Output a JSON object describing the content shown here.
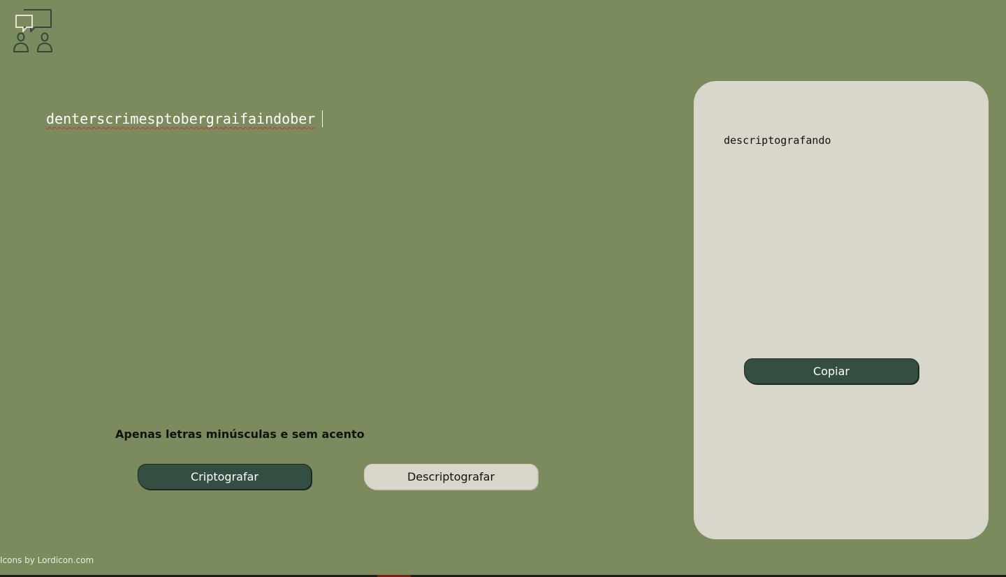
{
  "app": {
    "logo_icon": "chat-people-icon"
  },
  "input": {
    "value": "denterscrimesptobergraifaindober"
  },
  "hint": {
    "text": "Apenas letras minúsculas e sem acento"
  },
  "buttons": {
    "encrypt_label": "Criptografar",
    "decrypt_label": "Descriptografar"
  },
  "output": {
    "text": "descriptografando",
    "copy_label": "Copiar"
  },
  "footer": {
    "credit": "Icons by Lordicon.com"
  },
  "colors": {
    "background": "#7c8b5e",
    "panel": "#d9d7cc",
    "primary_button": "#344e42",
    "icon_dark": "#2f4a3b",
    "icon_light": "#e6e3d8"
  }
}
